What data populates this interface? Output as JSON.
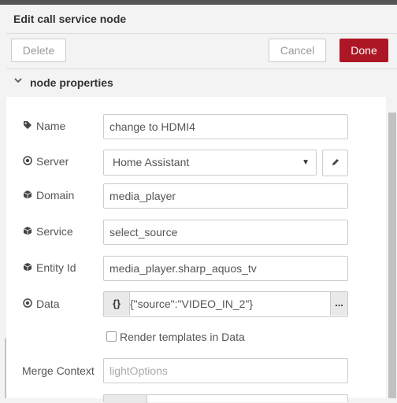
{
  "dialog": {
    "title": "Edit call service node",
    "delete_label": "Delete",
    "cancel_label": "Cancel",
    "done_label": "Done",
    "section_title": "node properties"
  },
  "form": {
    "name": {
      "label": "Name",
      "value": "change to HDMI4",
      "icon": "tag-icon"
    },
    "server": {
      "label": "Server",
      "value": "Home Assistant",
      "icon": "dot-circle-icon"
    },
    "domain": {
      "label": "Domain",
      "value": "media_player",
      "icon": "cube-icon"
    },
    "service": {
      "label": "Service",
      "value": "select_source",
      "icon": "cube-icon"
    },
    "entity_id": {
      "label": "Entity Id",
      "value": "media_player.sharp_aquos_tv",
      "icon": "cube-icon"
    },
    "data": {
      "label": "Data",
      "type_symbol": "{}",
      "value": "{\"source\":\"VIDEO_IN_2\"}",
      "more_symbol": "...",
      "icon": "dot-circle-icon"
    },
    "render_templates": {
      "label": "Render templates in Data",
      "checked": false
    },
    "merge_context": {
      "label": "Merge Context",
      "placeholder": "lightOptions"
    }
  },
  "colors": {
    "done": "#ad1625",
    "topbar": "#555555"
  }
}
